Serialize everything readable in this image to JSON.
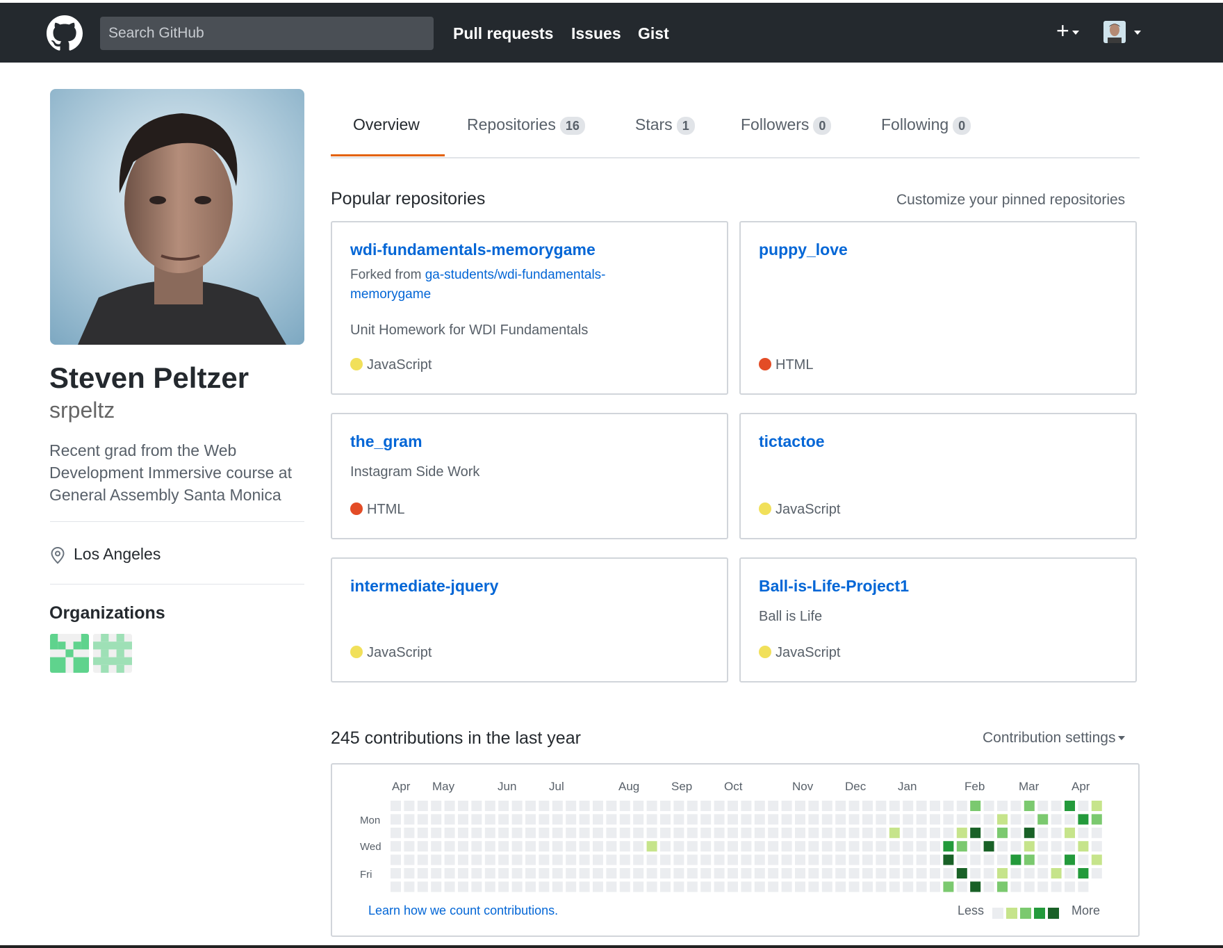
{
  "topbar": {
    "search_placeholder": "Search GitHub",
    "nav": [
      "Pull requests",
      "Issues",
      "Gist"
    ],
    "plus_label": "+"
  },
  "profile": {
    "name": "Steven Peltzer",
    "username": "srpeltz",
    "bio": "Recent grad from the Web Development Immersive course at General Assembly Santa Monica",
    "location": "Los Angeles",
    "organizations_title": "Organizations"
  },
  "tabs": [
    {
      "label": "Overview",
      "count": null
    },
    {
      "label": "Repositories",
      "count": "16"
    },
    {
      "label": "Stars",
      "count": "1"
    },
    {
      "label": "Followers",
      "count": "0"
    },
    {
      "label": "Following",
      "count": "0"
    }
  ],
  "popular": {
    "title": "Popular repositories",
    "customize": "Customize your pinned repositories",
    "repos": [
      {
        "name": "wdi-fundamentals-memorygame",
        "forked_prefix": "Forked from ",
        "forked_from": "ga-students/wdi-fundamentals-memorygame",
        "description": "Unit Homework for WDI Fundamentals",
        "language": "JavaScript",
        "lang_color": "#f1e05a"
      },
      {
        "name": "puppy_love",
        "description": "",
        "language": "HTML",
        "lang_color": "#e34c26"
      },
      {
        "name": "the_gram",
        "description": "Instagram Side Work",
        "language": "HTML",
        "lang_color": "#e34c26"
      },
      {
        "name": "tictactoe",
        "description": "",
        "language": "JavaScript",
        "lang_color": "#f1e05a"
      },
      {
        "name": "intermediate-jquery",
        "description": "",
        "language": "JavaScript",
        "lang_color": "#f1e05a"
      },
      {
        "name": "Ball-is-Life-Project1",
        "description": "Ball is Life",
        "language": "JavaScript",
        "lang_color": "#f1e05a"
      }
    ]
  },
  "contributions": {
    "title": "245 contributions in the last year",
    "settings": "Contribution settings",
    "months": [
      "Apr",
      "May",
      "Jun",
      "Jul",
      "Aug",
      "Sep",
      "Oct",
      "Nov",
      "Dec",
      "Jan",
      "Feb",
      "Mar",
      "Apr"
    ],
    "day_labels": [
      "Mon",
      "Wed",
      "Fri"
    ],
    "learn": "Learn how we count contributions.",
    "less": "Less",
    "more": "More",
    "levels": [
      "#ebedf0",
      "#c6e48b",
      "#7bc96f",
      "#239a3b",
      "#196127"
    ]
  }
}
